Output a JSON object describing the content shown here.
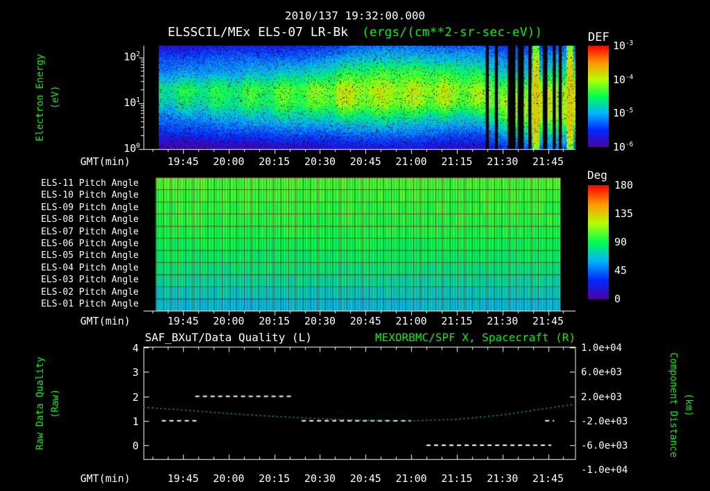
{
  "colors": {
    "background": "#000000",
    "text": "#ffffff",
    "accent_green": "#00ee00",
    "curve_green": "#00cc44",
    "grid_red": "#8c1919",
    "colormap": [
      "#5000a0",
      "#0028ff",
      "#00b4ff",
      "#00ff50",
      "#b4ff00",
      "#ff9600",
      "#ff0000"
    ]
  },
  "header": {
    "timestamp": "2010/137 19:32:00.000",
    "instrument": "ELSSCIL/MEx ELS-07 LR-Bk",
    "units": "(ergs/(cm**2-sr-sec-eV))"
  },
  "axis": {
    "gmt_label": "GMT(min)",
    "xtick_labels": [
      "19:45",
      "20:00",
      "20:15",
      "20:30",
      "20:45",
      "21:00",
      "21:15",
      "21:30",
      "21:45"
    ],
    "x_range_gmt": [
      "19:32",
      "21:54"
    ]
  },
  "panel1": {
    "ylabel_line1": "Electron Energy",
    "ylabel_line2": "(eV)",
    "ytick_exponents": [
      "2",
      "1",
      "0"
    ],
    "colorbar": {
      "title": "DEF",
      "tick_exponents": [
        "-3",
        "-4",
        "-5",
        "-6"
      ]
    }
  },
  "panel2": {
    "row_labels": [
      "ELS-11 Pitch Angle",
      "ELS-10 Pitch Angle",
      "ELS-09 Pitch Angle",
      "ELS-08 Pitch Angle",
      "ELS-07 Pitch Angle",
      "ELS-06 Pitch Angle",
      "ELS-05 Pitch Angle",
      "ELS-04 Pitch Angle",
      "ELS-03 Pitch Angle",
      "ELS-02 Pitch Angle",
      "ELS-01 Pitch Angle"
    ],
    "colorbar": {
      "title": "Deg",
      "tick_labels": [
        "180",
        "135",
        "90",
        "45",
        "0"
      ]
    }
  },
  "panel3": {
    "title_left": "SAF_BXuT/Data Quality (L)",
    "title_right": "MEXORBMC/SPF X, Spacecraft (R)",
    "ylabel_left_line1": "Raw Data Quality",
    "ylabel_left_line2": "(Raw)",
    "ylabel_right_line1": "Component Distance",
    "ylabel_right_line2": "(km)",
    "ytick_labels_left": [
      "4",
      "3",
      "2",
      "1",
      "0"
    ],
    "ytick_labels_right": [
      "1.0e+04",
      "6.0e+03",
      "2.0e+03",
      "-2.0e+03",
      "-6.0e+03",
      "-1.0e+04"
    ]
  },
  "chart_data": [
    {
      "type": "heatmap",
      "name": "electron-energy-spectrogram",
      "title": "ELSSCIL/MEx ELS-07 LR-Bk",
      "z_units": "ergs/(cm**2-sr-sec-eV)",
      "x_range_gmt": [
        "19:32",
        "21:54"
      ],
      "data_start_gmt": "19:37",
      "y_scale": "log",
      "y_range_ev": [
        1,
        178
      ],
      "z_scale": "log",
      "z_range": [
        1e-06,
        0.001
      ],
      "time_bins_gmt": [
        "19:37",
        "19:47",
        "19:57",
        "20:07",
        "20:17",
        "20:27",
        "20:37",
        "20:47",
        "20:57",
        "21:07",
        "21:17",
        "21:27",
        "21:37",
        "21:47"
      ],
      "energy_rows_ev": [
        100,
        50,
        20,
        10,
        5,
        2
      ],
      "log10_def": [
        [
          -5.4,
          -5.4,
          -5.3,
          -5.3,
          -5.3,
          -5.2,
          -5.0,
          -4.9,
          -4.9,
          -5.0,
          -5.0,
          -5.2,
          -5.1,
          -5.0
        ],
        [
          -5.2,
          -5.1,
          -5.1,
          -5.0,
          -4.9,
          -4.8,
          -4.5,
          -4.4,
          -4.4,
          -4.5,
          -4.6,
          -5.0,
          -4.8,
          -4.6
        ],
        [
          -4.6,
          -4.5,
          -4.5,
          -4.4,
          -4.3,
          -4.2,
          -4.0,
          -4.0,
          -4.0,
          -4.1,
          -4.1,
          -4.3,
          -4.0,
          -4.0
        ],
        [
          -4.8,
          -4.7,
          -4.6,
          -4.5,
          -4.4,
          -4.3,
          -4.1,
          -4.1,
          -4.1,
          -4.2,
          -4.2,
          -4.0,
          -3.9,
          -4.0
        ],
        [
          -5.2,
          -5.1,
          -5.0,
          -4.9,
          -4.8,
          -4.8,
          -4.7,
          -4.6,
          -4.7,
          -4.8,
          -4.8,
          -4.2,
          -4.0,
          -4.1
        ],
        [
          -5.6,
          -5.6,
          -5.5,
          -5.5,
          -5.4,
          -5.4,
          -5.3,
          -5.3,
          -5.3,
          -5.4,
          -5.4,
          -5.0,
          -4.8,
          -4.9
        ]
      ],
      "burst_interval_gmt": [
        "20:35",
        "21:20"
      ],
      "enhancement_times_gmt": [
        "21:41",
        "21:52"
      ],
      "data_gap_times_gmt": [
        "21:25",
        "21:28",
        "21:33",
        "21:36",
        "21:39",
        "21:44",
        "21:47",
        "21:49"
      ],
      "data_gap_widths_min": [
        1.0,
        1.0,
        2.5,
        2.0,
        1.0,
        1.5,
        1.0,
        1.0
      ]
    },
    {
      "type": "heatmap",
      "name": "pitch-angle-panels",
      "z_units": "deg",
      "z_range": [
        0,
        180
      ],
      "x_range_gmt": [
        "19:32",
        "21:54"
      ],
      "data_span_gmt": [
        "19:36",
        "21:49"
      ],
      "rows": [
        "ELS-11",
        "ELS-10",
        "ELS-09",
        "ELS-08",
        "ELS-07",
        "ELS-06",
        "ELS-05",
        "ELS-04",
        "ELS-03",
        "ELS-02",
        "ELS-01"
      ],
      "mean_pitch_angle_deg": [
        100,
        99,
        97,
        95,
        93,
        90,
        87,
        83,
        77,
        71,
        66
      ]
    },
    {
      "type": "line",
      "name": "data-quality-and-spacecraft-x",
      "x_range_gmt": [
        "19:32",
        "21:54"
      ],
      "left_axis": {
        "label": "Raw Data Quality (Raw)",
        "ticks": [
          4,
          3,
          2,
          1,
          0
        ]
      },
      "right_axis": {
        "label": "Component Distance (km)",
        "ticks": [
          10000,
          6000,
          2000,
          -2000,
          -6000,
          -10000
        ]
      },
      "axis_alignment": "left 4 aligns with right 1.0e+04, 4000 km per quality unit",
      "series": [
        {
          "name": "SAF_BXuT/Data Quality (L)",
          "color": "#ffffff",
          "style": "dashed",
          "axis": "left",
          "segments": [
            {
              "quality": 1,
              "from_gmt": "19:38",
              "to_gmt": "19:50"
            },
            {
              "quality": 2,
              "from_gmt": "19:49",
              "to_gmt": "20:21"
            },
            {
              "quality": 1,
              "from_gmt": "20:24",
              "to_gmt": "21:00"
            },
            {
              "quality": 0,
              "from_gmt": "21:05",
              "to_gmt": "21:46"
            },
            {
              "quality": 1,
              "from_gmt": "21:44",
              "to_gmt": "21:47"
            }
          ]
        },
        {
          "name": "MEXORBMC/SPF X, Spacecraft (R)",
          "color": "#00cc44",
          "style": "dotted",
          "axis": "right",
          "x_gmt": [
            "19:32",
            "19:45",
            "20:00",
            "20:15",
            "20:30",
            "20:45",
            "21:00",
            "21:15",
            "21:30",
            "21:45",
            "21:54"
          ],
          "km": [
            200,
            -240,
            -800,
            -1280,
            -1640,
            -1920,
            -2000,
            -1760,
            -1040,
            80,
            720
          ]
        }
      ]
    }
  ]
}
